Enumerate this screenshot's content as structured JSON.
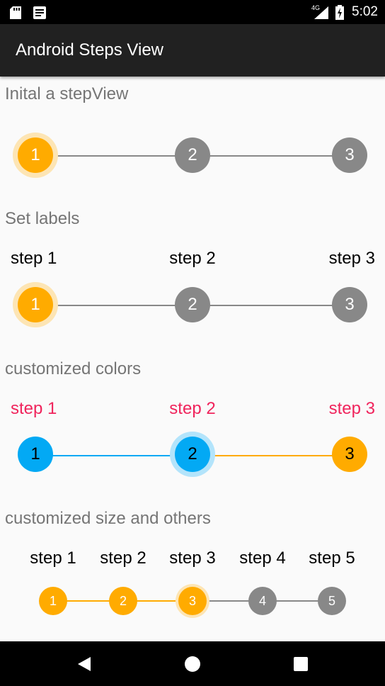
{
  "status_bar": {
    "time": "5:02",
    "network": "4G",
    "icons": [
      "sd-card-icon",
      "notification-icon",
      "signal-icon",
      "battery-charging-icon"
    ]
  },
  "app_bar": {
    "title": "Android Steps View"
  },
  "sections": [
    {
      "title": "Inital a stepView",
      "steps": [
        "1",
        "2",
        "3"
      ],
      "labels": [],
      "current": 1
    },
    {
      "title": "Set labels",
      "steps": [
        "1",
        "2",
        "3"
      ],
      "labels": [
        "step 1",
        "step 2",
        "step 3"
      ],
      "current": 1
    },
    {
      "title": "customized colors",
      "steps": [
        "1",
        "2",
        "3"
      ],
      "labels": [
        "step 1",
        "step 2",
        "step 3"
      ],
      "current": 2,
      "colors": {
        "completed": "#03a9f4",
        "pending": "#ffab00",
        "label": "#f0245c"
      }
    },
    {
      "title": "customized size and others",
      "steps": [
        "1",
        "2",
        "3",
        "4",
        "5"
      ],
      "labels": [
        "step 1",
        "step 2",
        "step 3",
        "step 4",
        "step 5"
      ],
      "current": 3
    }
  ],
  "colors": {
    "active": "#ffab00",
    "inactive": "#888888",
    "active_halo": "#fde5b4",
    "blue": "#03a9f4",
    "blue_halo": "#b3e4fb",
    "heading": "#757575",
    "appbar": "#212121"
  },
  "nav_bar": {
    "buttons": [
      "back-icon",
      "home-icon",
      "recents-icon"
    ]
  }
}
